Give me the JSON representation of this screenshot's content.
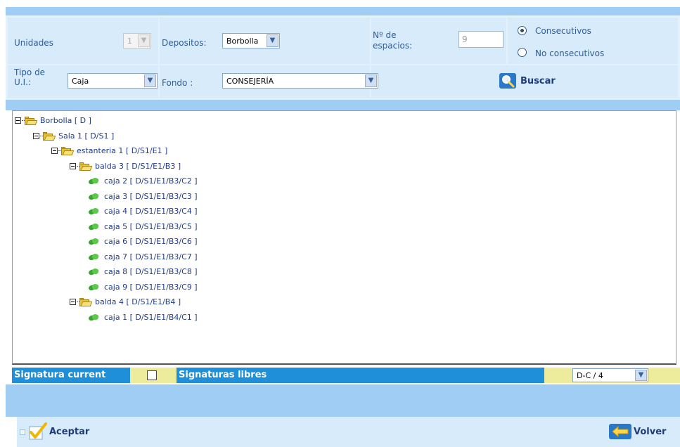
{
  "filters": {
    "unidades": {
      "label": "Unidades",
      "value": "1"
    },
    "depositos": {
      "label": "Depositos:",
      "value": "Borbolla"
    },
    "espacios": {
      "label_line1": "Nº de",
      "label_line2": "espacios:",
      "value": "9"
    },
    "radio": [
      {
        "label": "Consecutivos",
        "checked": true
      },
      {
        "label": "No consecutivos",
        "checked": false
      }
    ],
    "tipo": {
      "label_line1": "Tipo de",
      "label_line2": "U.I.:",
      "value": "Caja"
    },
    "fondo": {
      "label": "Fondo :",
      "value": "CONSEJERÍA"
    },
    "search_label": "Buscar"
  },
  "tree": [
    {
      "label": "Borbolla [ D ]",
      "kind": "folder",
      "level": 0
    },
    {
      "label": "Sala 1 [ D/S1 ]",
      "kind": "folder",
      "level": 1
    },
    {
      "label": "estanteria 1 [ D/S1/E1 ]",
      "kind": "folder",
      "level": 2
    },
    {
      "label": "balda 3 [ D/S1/E1/B3 ]",
      "kind": "folder",
      "level": 3
    },
    {
      "label": "caja 2 [ D/S1/E1/B3/C2 ]",
      "kind": "leaf",
      "level": 4
    },
    {
      "label": "caja 3 [ D/S1/E1/B3/C3 ]",
      "kind": "leaf",
      "level": 4
    },
    {
      "label": "caja 4 [ D/S1/E1/B3/C4 ]",
      "kind": "leaf",
      "level": 4
    },
    {
      "label": "caja 5 [ D/S1/E1/B3/C5 ]",
      "kind": "leaf",
      "level": 4
    },
    {
      "label": "caja 6 [ D/S1/E1/B3/C6 ]",
      "kind": "leaf",
      "level": 4
    },
    {
      "label": "caja 7 [ D/S1/E1/B3/C7 ]",
      "kind": "leaf",
      "level": 4
    },
    {
      "label": "caja 8 [ D/S1/E1/B3/C8 ]",
      "kind": "leaf",
      "level": 4
    },
    {
      "label": "caja 9 [ D/S1/E1/B3/C9 ]",
      "kind": "leaf",
      "level": 4
    },
    {
      "label": "balda 4 [ D/S1/E1/B4 ]",
      "kind": "folder",
      "level": 3
    },
    {
      "label": "caja 1 [ D/S1/E1/B4/C1 ]",
      "kind": "leaf",
      "level": 4
    }
  ],
  "signature": {
    "current_label": "Signatura current",
    "current_checked": false,
    "libres_label": "Signaturas libres",
    "libres_value": "D-C / 4"
  },
  "footer": {
    "accept_label": "Aceptar",
    "back_label": "Volver"
  },
  "icons": {
    "search": "magnifier-icon",
    "folder": "folder-open-icon",
    "leaf": "leaf-icon",
    "accept": "checkmark-icon",
    "back": "arrow-left-icon"
  },
  "colors": {
    "band": "#9fcdf4",
    "filter_bg": "#e3f1fc",
    "sig_dark": "#1e8fd8",
    "sig_light": "#ecec9c",
    "footer_bg": "#d7ebfb",
    "text": "#2e5d99"
  }
}
